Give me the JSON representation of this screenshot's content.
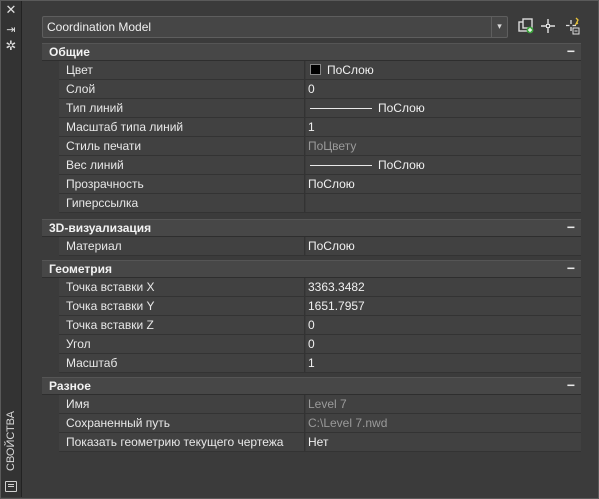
{
  "sidebar": {
    "close_glyph": "✕",
    "pin_glyph": "⇥",
    "settings_glyph": "✲",
    "title": "СВОЙСТВА"
  },
  "toolbar": {
    "selection": "Coordination Model",
    "dropdown_glyph": "▾",
    "tool_icons": [
      "quick-select-icon",
      "select-objects-icon",
      "toggle-pickadd-icon"
    ]
  },
  "categories": [
    {
      "label": "Общие",
      "collapse": "−",
      "rows": [
        {
          "name": "Цвет",
          "value": "ПоСлою",
          "swatch": "#000000"
        },
        {
          "name": "Слой",
          "value": "0"
        },
        {
          "name": "Тип линий",
          "value": "ПоСлою",
          "line": true
        },
        {
          "name": "Масштаб типа линий",
          "value": "1"
        },
        {
          "name": "Стиль печати",
          "value": "ПоЦвету",
          "dim_value": true
        },
        {
          "name": "Вес линий",
          "value": "ПоСлою",
          "line": true
        },
        {
          "name": "Прозрачность",
          "value": "ПоСлою"
        },
        {
          "name": "Гиперссылка",
          "value": ""
        }
      ]
    },
    {
      "label": "3D-визуализация",
      "collapse": "−",
      "rows": [
        {
          "name": "Материал",
          "value": "ПоСлою"
        }
      ]
    },
    {
      "label": "Геометрия",
      "collapse": "−",
      "rows": [
        {
          "name": "Точка вставки X",
          "value": "3363.3482"
        },
        {
          "name": "Точка вставки Y",
          "value": "1651.7957"
        },
        {
          "name": "Точка вставки Z",
          "value": "0"
        },
        {
          "name": "Угол",
          "value": "0"
        },
        {
          "name": "Масштаб",
          "value": "1"
        }
      ]
    },
    {
      "label": "Разное",
      "collapse": "−",
      "rows": [
        {
          "name": "Имя",
          "value": "Level 7",
          "dim_value": true
        },
        {
          "name": "Сохраненный путь",
          "value": "C:\\Level 7.nwd",
          "dim_value": true
        },
        {
          "name": "Показать геометрию текущего чертежа",
          "value": "Нет"
        }
      ]
    }
  ]
}
